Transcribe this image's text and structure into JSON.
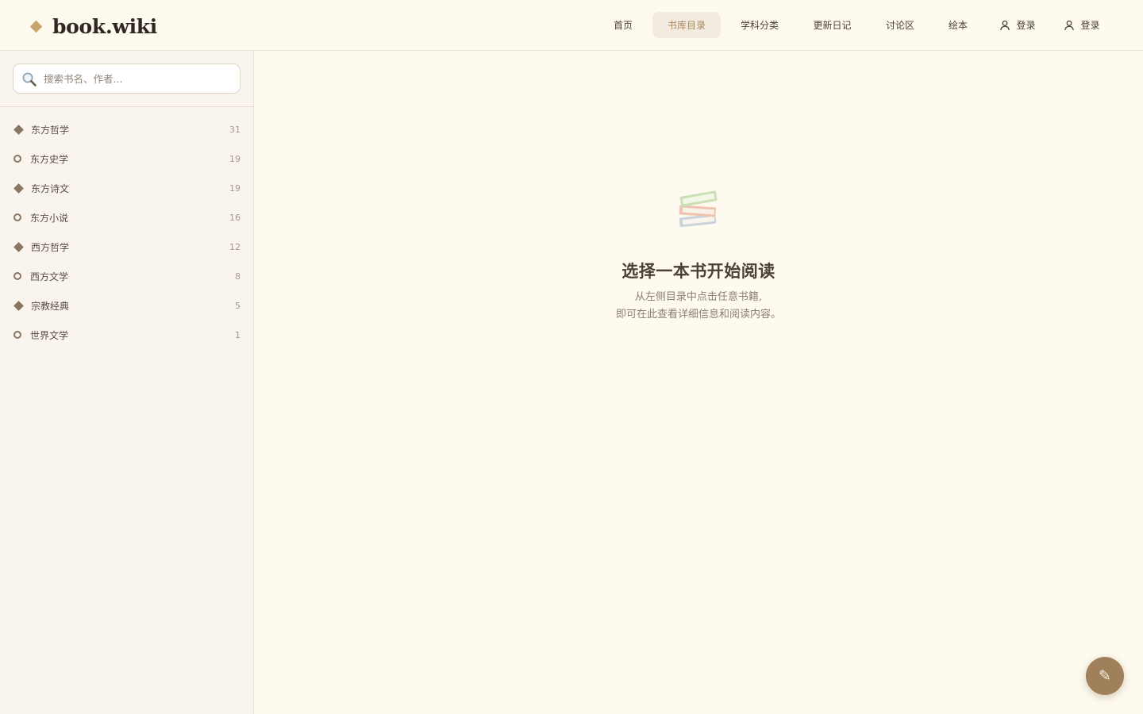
{
  "brand": {
    "name": "book.wiki"
  },
  "nav": {
    "items": [
      {
        "label": "首页"
      },
      {
        "label": "书库目录"
      },
      {
        "label": "学科分类"
      },
      {
        "label": "更新日记"
      },
      {
        "label": "讨论区"
      },
      {
        "label": "绘本"
      },
      {
        "label": "登录",
        "icon": "user-icon"
      },
      {
        "label": "登录",
        "icon": "user-icon"
      }
    ],
    "active": "书库目录"
  },
  "search": {
    "placeholder": "搜索书名、作者...",
    "value": ""
  },
  "categories": [
    {
      "label": "东方哲学",
      "count": "31",
      "marker": "diamond"
    },
    {
      "label": "东方史学",
      "count": "19",
      "marker": "circle"
    },
    {
      "label": "东方诗文",
      "count": "19",
      "marker": "diamond"
    },
    {
      "label": "东方小说",
      "count": "16",
      "marker": "circle"
    },
    {
      "label": "西方哲学",
      "count": "12",
      "marker": "diamond"
    },
    {
      "label": "西方文学",
      "count": "8",
      "marker": "circle"
    },
    {
      "label": "宗教经典",
      "count": "5",
      "marker": "diamond"
    },
    {
      "label": "世界文学",
      "count": "1",
      "marker": "circle"
    }
  ],
  "empty_state": {
    "icon": "books-icon",
    "title": "选择一本书开始阅读",
    "line1": "从左侧目录中点击任意书籍,",
    "line2": "即可在此查看详细信息和阅读内容。"
  },
  "fab": {
    "icon": "pencil-icon"
  },
  "colors": {
    "background": "#fefaf0",
    "sidebar": "#f9f5ee",
    "accent": "#a0805a",
    "logo_mark": "#c9a56b",
    "nav_active_bg": "#f4ebe0"
  }
}
